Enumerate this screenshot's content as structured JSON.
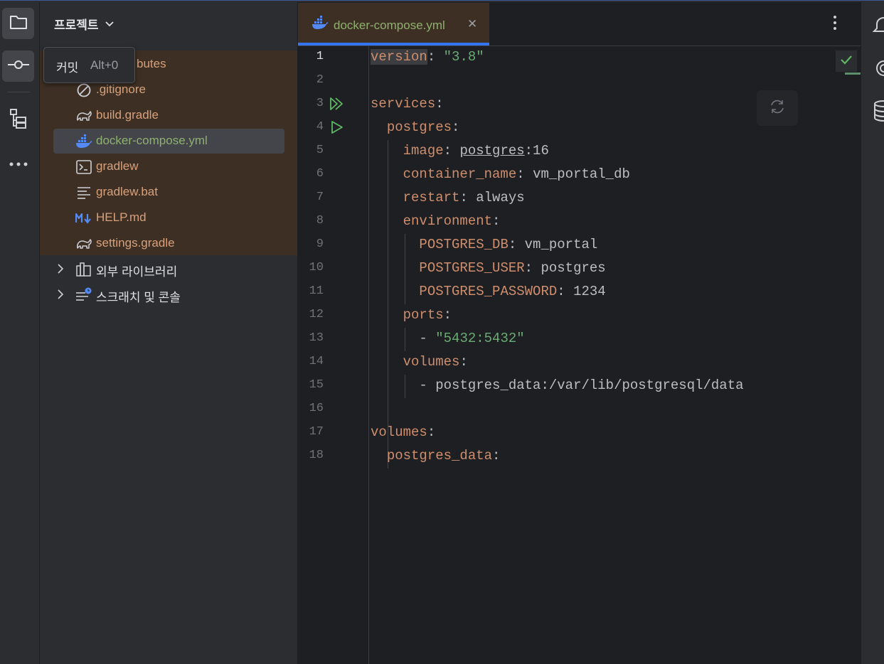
{
  "project_panel": {
    "title": "프로젝트",
    "files": [
      {
        "label": ".gitattributes",
        "visible_label": "butes",
        "icon": "file-icon",
        "color": "#d8a17c"
      },
      {
        "label": ".gitignore",
        "icon": "ignore-file-icon",
        "color": "#d8a17c"
      },
      {
        "label": "build.gradle",
        "icon": "gradle-elephant-icon",
        "color": "#d8a17c"
      },
      {
        "label": "docker-compose.yml",
        "icon": "docker-icon",
        "color": "#8fb06f"
      },
      {
        "label": "gradlew",
        "icon": "terminal-icon",
        "color": "#d8a17c"
      },
      {
        "label": "gradlew.bat",
        "icon": "text-file-icon",
        "color": "#d8a17c"
      },
      {
        "label": "HELP.md",
        "icon": "markdown-icon",
        "color": "#d8a17c"
      },
      {
        "label": "settings.gradle",
        "icon": "gradle-elephant-icon",
        "color": "#d8a17c"
      }
    ],
    "nodes": [
      {
        "label": "외부 라이브러리",
        "icon": "library-icon"
      },
      {
        "label": "스크래치 및 콘솔",
        "icon": "scratches-icon"
      }
    ]
  },
  "tooltip": {
    "label": "커밋",
    "shortcut": "Alt+0"
  },
  "editor": {
    "tab": {
      "label": "docker-compose.yml",
      "close": "✕"
    },
    "line_numbers": [
      "1",
      "2",
      "3",
      "4",
      "5",
      "6",
      "7",
      "8",
      "9",
      "10",
      "11",
      "12",
      "13",
      "14",
      "15",
      "16",
      "17",
      "18"
    ],
    "code": {
      "l1_key": "version",
      "l1_colon": ": ",
      "l1_val": "\"3.8\"",
      "l3_key": "services",
      "colon": ":",
      "l4_key": "postgres",
      "l5_key": "image",
      "l5_val_a": "postgres",
      "l5_val_b": ":16",
      "l6_key": "container_name",
      "l6_val": "vm_portal_db",
      "l7_key": "restart",
      "l7_val": "always",
      "l8_key": "environment",
      "l9_key": "POSTGRES_DB",
      "l9_val": "vm_portal",
      "l10_key": "POSTGRES_USER",
      "l10_val": "postgres",
      "l11_key": "POSTGRES_PASSWORD",
      "l11_val": "1234",
      "l12_key": "ports",
      "l13_dash": "- ",
      "l13_val": "\"5432:5432\"",
      "l14_key": "volumes",
      "l15_dash": "- ",
      "l15_val": "postgres_data:/var/lib/postgresql/data",
      "l17_key": "volumes",
      "l18_key": "postgres_data"
    }
  },
  "colors": {
    "accent": "#3574f0",
    "modified_file": "#d8a17c",
    "current_file": "#8fb06f",
    "yaml_key": "#cf8e6d",
    "yaml_string": "#6aab73"
  }
}
